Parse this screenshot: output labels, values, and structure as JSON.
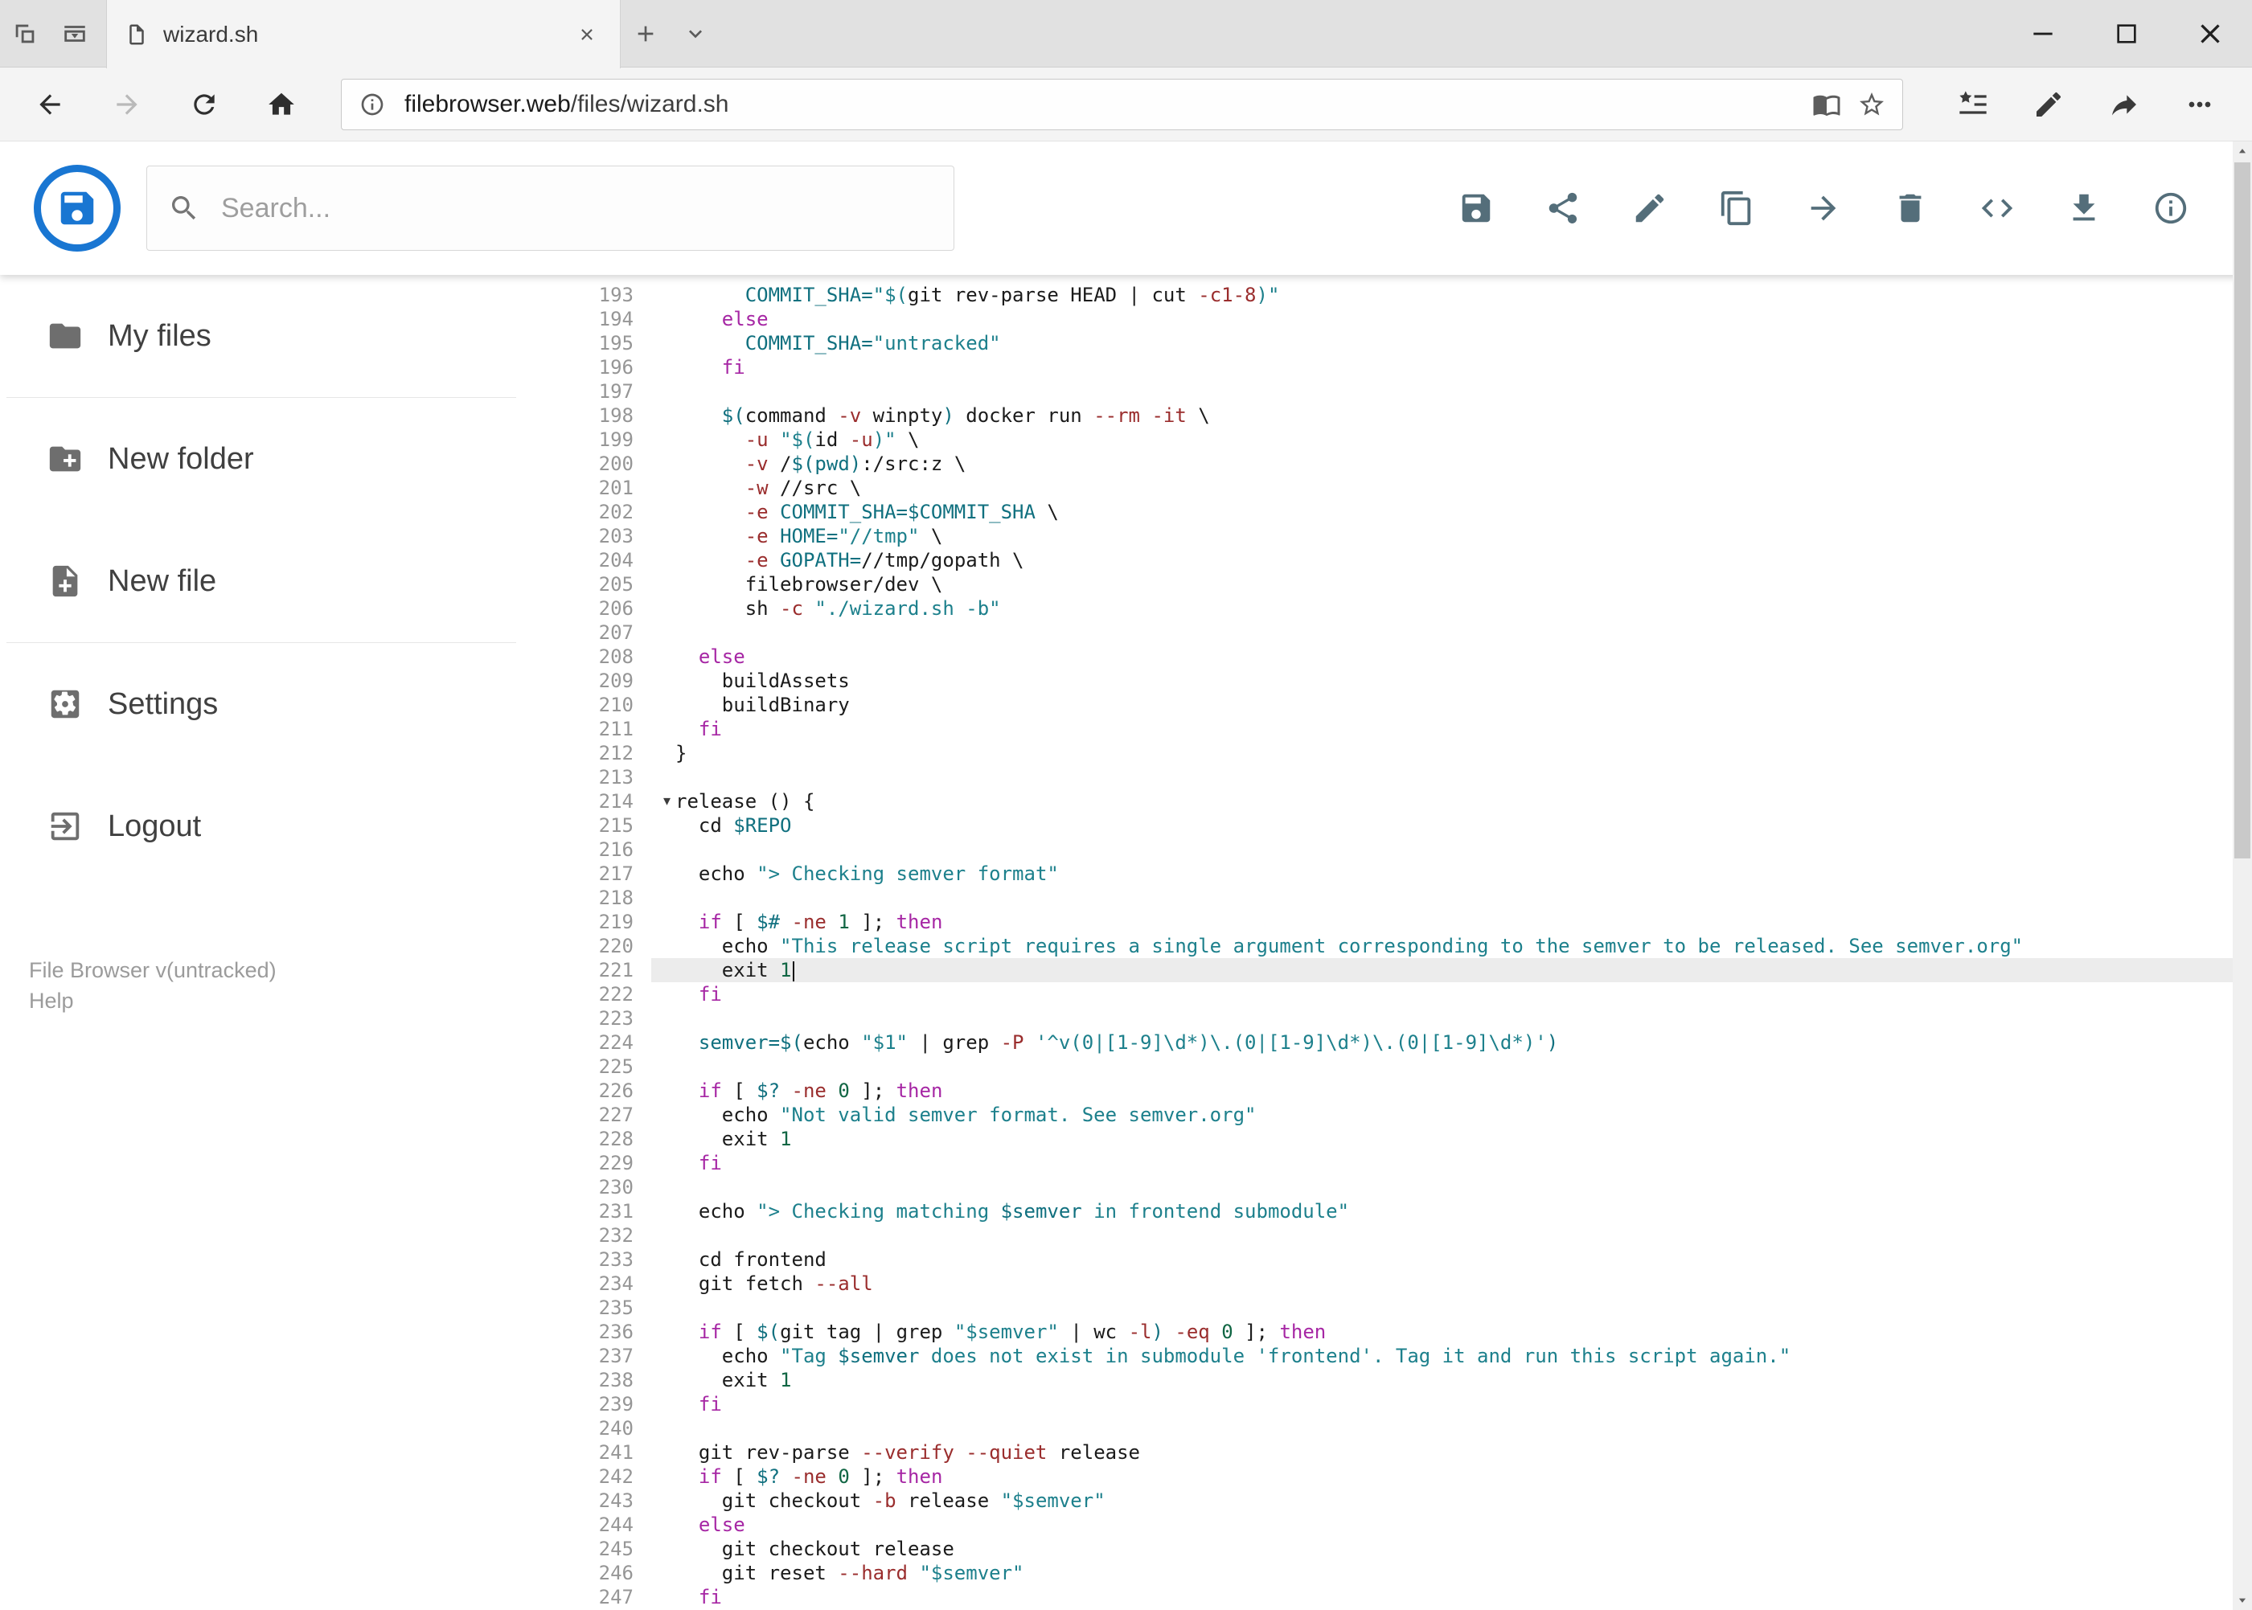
{
  "browser": {
    "tab_title": "wizard.sh",
    "url_domain": "filebrowser.web",
    "url_path": "/files/wizard.sh",
    "tabstrip_buttons": [
      {
        "name": "set-tabs-aside-button",
        "icon": "set-tabs-aside-icon"
      },
      {
        "name": "tab-preview-button",
        "icon": "tab-preview-icon"
      }
    ],
    "tab_controls": [
      {
        "name": "new-tab-button",
        "icon": "plus-icon"
      },
      {
        "name": "tab-list-button",
        "icon": "chevron-down-icon"
      }
    ],
    "window_controls": [
      {
        "name": "minimize-button",
        "icon": "minimize-icon"
      },
      {
        "name": "maximize-button",
        "icon": "maximize-icon"
      },
      {
        "name": "close-window-button",
        "icon": "close-icon"
      }
    ],
    "nav_buttons": [
      {
        "name": "back-button",
        "icon": "back-icon",
        "disabled": false
      },
      {
        "name": "forward-button",
        "icon": "forward-icon",
        "disabled": true
      },
      {
        "name": "refresh-button",
        "icon": "refresh-icon",
        "disabled": false
      },
      {
        "name": "home-button",
        "icon": "home-icon",
        "disabled": false
      }
    ],
    "address_left": [
      {
        "name": "site-info-button",
        "icon": "info-icon"
      }
    ],
    "address_right": [
      {
        "name": "reading-view-button",
        "icon": "book-icon"
      },
      {
        "name": "favorite-button",
        "icon": "star-icon"
      }
    ],
    "action_buttons": [
      {
        "name": "favorites-hub-button",
        "icon": "favorites-list-icon"
      },
      {
        "name": "web-note-button",
        "icon": "pen-icon"
      },
      {
        "name": "share-page-button",
        "icon": "share-arrow-icon"
      },
      {
        "name": "more-button",
        "icon": "ellipsis-icon"
      }
    ]
  },
  "header": {
    "search_placeholder": "Search...",
    "toolbar_buttons": [
      {
        "name": "save-button",
        "icon": "save-icon"
      },
      {
        "name": "share-button",
        "icon": "share-icon"
      },
      {
        "name": "rename-button",
        "icon": "pencil-icon"
      },
      {
        "name": "copy-button",
        "icon": "copy-icon"
      },
      {
        "name": "move-button",
        "icon": "arrow-right-icon"
      },
      {
        "name": "delete-button",
        "icon": "trash-icon"
      },
      {
        "name": "raw-view-button",
        "icon": "code-icon"
      },
      {
        "name": "download-button",
        "icon": "download-icon"
      },
      {
        "name": "info-button",
        "icon": "info-circle-icon"
      }
    ]
  },
  "sidebar": {
    "items": [
      {
        "name": "sidebar-item-my-files",
        "label": "My files",
        "icon": "folder-icon",
        "divider_after": true
      },
      {
        "name": "sidebar-item-new-folder",
        "label": "New folder",
        "icon": "folder-plus-icon",
        "divider_after": false
      },
      {
        "name": "sidebar-item-new-file",
        "label": "New file",
        "icon": "file-plus-icon",
        "divider_after": true
      },
      {
        "name": "sidebar-item-settings",
        "label": "Settings",
        "icon": "gear-icon",
        "divider_after": false
      },
      {
        "name": "sidebar-item-logout",
        "label": "Logout",
        "icon": "logout-icon",
        "divider_after": false
      }
    ],
    "footer": {
      "version": "File Browser v(untracked)",
      "help": "Help"
    }
  },
  "editor": {
    "first_line": 193,
    "active_line": 221,
    "fold_marker_line": 214,
    "lines": [
      {
        "n": 193,
        "s": [
          [
            "p",
            "      "
          ],
          [
            "v",
            "COMMIT_SHA="
          ],
          [
            "s",
            "\"$("
          ],
          [
            "p",
            "git rev-parse HEAD | cut "
          ],
          [
            "a",
            "-c1-8"
          ],
          [
            "s",
            ")\""
          ]
        ]
      },
      {
        "n": 194,
        "s": [
          [
            "p",
            "    "
          ],
          [
            "k",
            "else"
          ]
        ]
      },
      {
        "n": 195,
        "s": [
          [
            "p",
            "      "
          ],
          [
            "v",
            "COMMIT_SHA="
          ],
          [
            "s",
            "\"untracked\""
          ]
        ]
      },
      {
        "n": 196,
        "s": [
          [
            "p",
            "    "
          ],
          [
            "k",
            "fi"
          ]
        ]
      },
      {
        "n": 197,
        "s": []
      },
      {
        "n": 198,
        "s": [
          [
            "p",
            "    "
          ],
          [
            "v",
            "$("
          ],
          [
            "p",
            "command "
          ],
          [
            "a",
            "-v"
          ],
          [
            "p",
            " winpty"
          ],
          [
            "v",
            ")"
          ],
          [
            "p",
            " docker run "
          ],
          [
            "a",
            "--rm"
          ],
          [
            "p",
            " "
          ],
          [
            "a",
            "-it"
          ],
          [
            "p",
            " \\"
          ]
        ]
      },
      {
        "n": 199,
        "s": [
          [
            "p",
            "      "
          ],
          [
            "a",
            "-u"
          ],
          [
            "p",
            " "
          ],
          [
            "s",
            "\"$("
          ],
          [
            "p",
            "id "
          ],
          [
            "a",
            "-u"
          ],
          [
            "s",
            ")\""
          ],
          [
            "p",
            " \\"
          ]
        ]
      },
      {
        "n": 200,
        "s": [
          [
            "p",
            "      "
          ],
          [
            "a",
            "-v"
          ],
          [
            "p",
            " /"
          ],
          [
            "v",
            "$(pwd)"
          ],
          [
            "p",
            ":/src:z \\"
          ]
        ]
      },
      {
        "n": 201,
        "s": [
          [
            "p",
            "      "
          ],
          [
            "a",
            "-w"
          ],
          [
            "p",
            " //src \\"
          ]
        ]
      },
      {
        "n": 202,
        "s": [
          [
            "p",
            "      "
          ],
          [
            "a",
            "-e"
          ],
          [
            "p",
            " "
          ],
          [
            "v",
            "COMMIT_SHA=$COMMIT_SHA"
          ],
          [
            "p",
            " \\"
          ]
        ]
      },
      {
        "n": 203,
        "s": [
          [
            "p",
            "      "
          ],
          [
            "a",
            "-e"
          ],
          [
            "p",
            " "
          ],
          [
            "v",
            "HOME="
          ],
          [
            "s",
            "\"//tmp\""
          ],
          [
            "p",
            " \\"
          ]
        ]
      },
      {
        "n": 204,
        "s": [
          [
            "p",
            "      "
          ],
          [
            "a",
            "-e"
          ],
          [
            "p",
            " "
          ],
          [
            "v",
            "GOPATH="
          ],
          [
            "p",
            "//tmp/gopath \\"
          ]
        ]
      },
      {
        "n": 205,
        "s": [
          [
            "p",
            "      filebrowser/dev \\"
          ]
        ]
      },
      {
        "n": 206,
        "s": [
          [
            "p",
            "      sh "
          ],
          [
            "a",
            "-c"
          ],
          [
            "p",
            " "
          ],
          [
            "s",
            "\"./wizard.sh -b\""
          ]
        ]
      },
      {
        "n": 207,
        "s": []
      },
      {
        "n": 208,
        "s": [
          [
            "p",
            "  "
          ],
          [
            "k",
            "else"
          ]
        ]
      },
      {
        "n": 209,
        "s": [
          [
            "p",
            "    buildAssets"
          ]
        ]
      },
      {
        "n": 210,
        "s": [
          [
            "p",
            "    buildBinary"
          ]
        ]
      },
      {
        "n": 211,
        "s": [
          [
            "p",
            "  "
          ],
          [
            "k",
            "fi"
          ]
        ]
      },
      {
        "n": 212,
        "s": [
          [
            "p",
            "}"
          ]
        ]
      },
      {
        "n": 213,
        "s": []
      },
      {
        "n": 214,
        "s": [
          [
            "p",
            "release () {"
          ]
        ]
      },
      {
        "n": 215,
        "s": [
          [
            "p",
            "  cd "
          ],
          [
            "v",
            "$REPO"
          ]
        ]
      },
      {
        "n": 216,
        "s": []
      },
      {
        "n": 217,
        "s": [
          [
            "p",
            "  echo "
          ],
          [
            "s",
            "\"> Checking semver format\""
          ]
        ]
      },
      {
        "n": 218,
        "s": []
      },
      {
        "n": 219,
        "s": [
          [
            "p",
            "  "
          ],
          [
            "k",
            "if"
          ],
          [
            "p",
            " [ "
          ],
          [
            "v",
            "$#"
          ],
          [
            "p",
            " "
          ],
          [
            "a",
            "-ne"
          ],
          [
            "p",
            " "
          ],
          [
            "n",
            "1"
          ],
          [
            "p",
            " ]; "
          ],
          [
            "k",
            "then"
          ]
        ]
      },
      {
        "n": 220,
        "s": [
          [
            "p",
            "    echo "
          ],
          [
            "s",
            "\"This release script requires a single argument corresponding to the semver to be released. See semver.org\""
          ]
        ]
      },
      {
        "n": 221,
        "s": [
          [
            "p",
            "    exit "
          ],
          [
            "n",
            "1"
          ]
        ]
      },
      {
        "n": 222,
        "s": [
          [
            "p",
            "  "
          ],
          [
            "k",
            "fi"
          ]
        ]
      },
      {
        "n": 223,
        "s": []
      },
      {
        "n": 224,
        "s": [
          [
            "p",
            "  "
          ],
          [
            "v",
            "semver=$("
          ],
          [
            "p",
            "echo "
          ],
          [
            "s",
            "\"$1\""
          ],
          [
            "p",
            " | grep "
          ],
          [
            "a",
            "-P"
          ],
          [
            "p",
            " "
          ],
          [
            "s",
            "'^v(0|[1-9]\\d*)\\.(0|[1-9]\\d*)\\.(0|[1-9]\\d*)'"
          ],
          [
            "v",
            ")"
          ]
        ]
      },
      {
        "n": 225,
        "s": []
      },
      {
        "n": 226,
        "s": [
          [
            "p",
            "  "
          ],
          [
            "k",
            "if"
          ],
          [
            "p",
            " [ "
          ],
          [
            "v",
            "$?"
          ],
          [
            "p",
            " "
          ],
          [
            "a",
            "-ne"
          ],
          [
            "p",
            " "
          ],
          [
            "n",
            "0"
          ],
          [
            "p",
            " ]; "
          ],
          [
            "k",
            "then"
          ]
        ]
      },
      {
        "n": 227,
        "s": [
          [
            "p",
            "    echo "
          ],
          [
            "s",
            "\"Not valid semver format. See semver.org\""
          ]
        ]
      },
      {
        "n": 228,
        "s": [
          [
            "p",
            "    exit "
          ],
          [
            "n",
            "1"
          ]
        ]
      },
      {
        "n": 229,
        "s": [
          [
            "p",
            "  "
          ],
          [
            "k",
            "fi"
          ]
        ]
      },
      {
        "n": 230,
        "s": []
      },
      {
        "n": 231,
        "s": [
          [
            "p",
            "  echo "
          ],
          [
            "s",
            "\"> Checking matching "
          ],
          [
            "v",
            "$semver"
          ],
          [
            "s",
            " in frontend submodule\""
          ]
        ]
      },
      {
        "n": 232,
        "s": []
      },
      {
        "n": 233,
        "s": [
          [
            "p",
            "  cd frontend"
          ]
        ]
      },
      {
        "n": 234,
        "s": [
          [
            "p",
            "  git fetch "
          ],
          [
            "a",
            "--all"
          ]
        ]
      },
      {
        "n": 235,
        "s": []
      },
      {
        "n": 236,
        "s": [
          [
            "p",
            "  "
          ],
          [
            "k",
            "if"
          ],
          [
            "p",
            " [ "
          ],
          [
            "v",
            "$("
          ],
          [
            "p",
            "git tag | grep "
          ],
          [
            "s",
            "\"$semver\""
          ],
          [
            "p",
            " | wc "
          ],
          [
            "a",
            "-l"
          ],
          [
            "v",
            ")"
          ],
          [
            "p",
            " "
          ],
          [
            "a",
            "-eq"
          ],
          [
            "p",
            " "
          ],
          [
            "n",
            "0"
          ],
          [
            "p",
            " ]; "
          ],
          [
            "k",
            "then"
          ]
        ]
      },
      {
        "n": 237,
        "s": [
          [
            "p",
            "    echo "
          ],
          [
            "s",
            "\"Tag "
          ],
          [
            "v",
            "$semver"
          ],
          [
            "s",
            " does not exist in submodule 'frontend'. Tag it and run this script again.\""
          ]
        ]
      },
      {
        "n": 238,
        "s": [
          [
            "p",
            "    exit "
          ],
          [
            "n",
            "1"
          ]
        ]
      },
      {
        "n": 239,
        "s": [
          [
            "p",
            "  "
          ],
          [
            "k",
            "fi"
          ]
        ]
      },
      {
        "n": 240,
        "s": []
      },
      {
        "n": 241,
        "s": [
          [
            "p",
            "  git rev-parse "
          ],
          [
            "a",
            "--verify"
          ],
          [
            "p",
            " "
          ],
          [
            "a",
            "--quiet"
          ],
          [
            "p",
            " release"
          ]
        ]
      },
      {
        "n": 242,
        "s": [
          [
            "p",
            "  "
          ],
          [
            "k",
            "if"
          ],
          [
            "p",
            " [ "
          ],
          [
            "v",
            "$?"
          ],
          [
            "p",
            " "
          ],
          [
            "a",
            "-ne"
          ],
          [
            "p",
            " "
          ],
          [
            "n",
            "0"
          ],
          [
            "p",
            " ]; "
          ],
          [
            "k",
            "then"
          ]
        ]
      },
      {
        "n": 243,
        "s": [
          [
            "p",
            "    git checkout "
          ],
          [
            "a",
            "-b"
          ],
          [
            "p",
            " release "
          ],
          [
            "s",
            "\"$semver\""
          ]
        ]
      },
      {
        "n": 244,
        "s": [
          [
            "p",
            "  "
          ],
          [
            "k",
            "else"
          ]
        ]
      },
      {
        "n": 245,
        "s": [
          [
            "p",
            "    git checkout release"
          ]
        ]
      },
      {
        "n": 246,
        "s": [
          [
            "p",
            "    git reset "
          ],
          [
            "a",
            "--hard"
          ],
          [
            "p",
            " "
          ],
          [
            "s",
            "\"$semver\""
          ]
        ]
      },
      {
        "n": 247,
        "s": [
          [
            "p",
            "  "
          ],
          [
            "k",
            "fi"
          ]
        ]
      }
    ]
  },
  "colors": {
    "accent_blue": "#1976d2",
    "toolbar_icon": "#546e7a",
    "syntax_keyword": "#a626a4",
    "syntax_string": "#1d808c",
    "syntax_variable": "#10707f",
    "syntax_flag": "#9a2d2d",
    "syntax_number": "#116644"
  }
}
